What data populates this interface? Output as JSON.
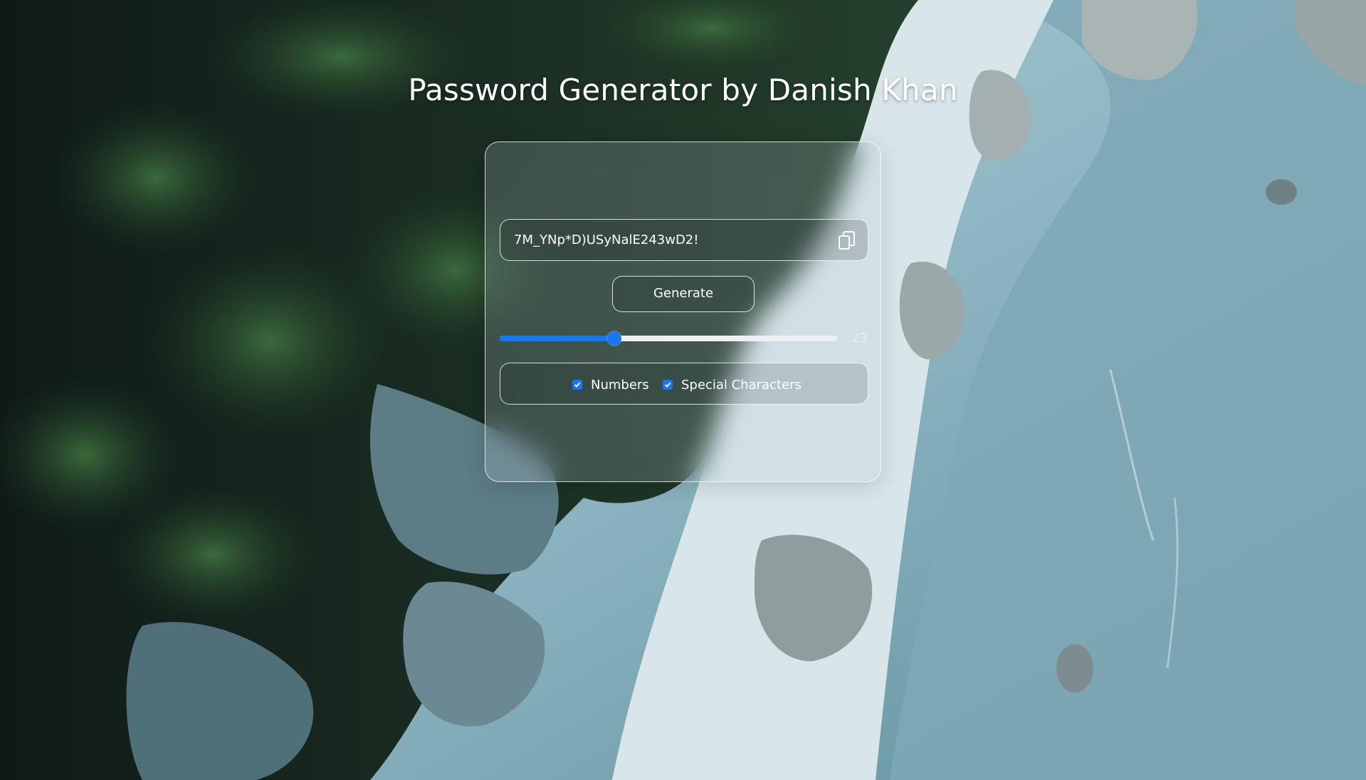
{
  "page": {
    "title": "Password Generator by Danish Khan"
  },
  "generator": {
    "password": "7M_YNp*D)USyNalE243wD2!",
    "copy_icon": "copy-icon",
    "generate_label": "Generate",
    "length": {
      "value": "23",
      "fraction": 0.34
    },
    "options": {
      "numbers_label": "Numbers",
      "numbers_checked": true,
      "special_label": "Special Characters",
      "special_checked": true
    }
  },
  "colors": {
    "accent": "#1877f2",
    "text": "#ffffff"
  }
}
